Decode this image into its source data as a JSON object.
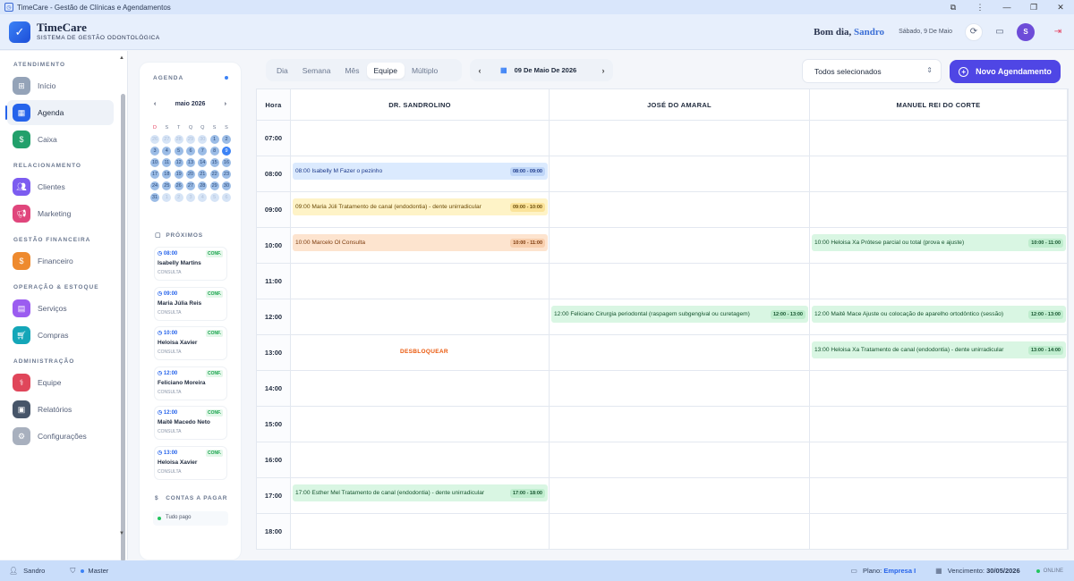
{
  "window": {
    "title": "TimeCare - Gestão de Clínicas e Agendamentos",
    "controls": [
      "⧉",
      "⋮",
      "—",
      "❐",
      "✕"
    ]
  },
  "header": {
    "app_name": "TimeCare",
    "subtitle": "SISTEMA DE GESTÃO ODONTOLÓGICA",
    "greeting": "Bom dia,",
    "user": "Sandro",
    "date": "Sábado, 9 De Maio",
    "avatar": "S"
  },
  "sidebar": {
    "sections": [
      {
        "title": "ATENDIMENTO",
        "items": [
          {
            "label": "Início",
            "icon": "home-icon",
            "color": "#94a3b8"
          },
          {
            "label": "Agenda",
            "icon": "calendar-icon",
            "color": "#2563eb"
          },
          {
            "label": "Caixa",
            "icon": "dollar-icon",
            "color": "#22a06b"
          }
        ]
      },
      {
        "title": "RELACIONAMENTO",
        "items": [
          {
            "label": "Clientes",
            "icon": "users-icon",
            "color": "#7c5cf0"
          },
          {
            "label": "Marketing",
            "icon": "megaphone-icon",
            "color": "#e0467c"
          }
        ]
      },
      {
        "title": "GESTÃO FINANCEIRA",
        "items": [
          {
            "label": "Financeiro",
            "icon": "dollar-icon",
            "color": "#ee8a2e"
          }
        ]
      },
      {
        "title": "OPERAÇÃO & ESTOQUE",
        "items": [
          {
            "label": "Serviços",
            "icon": "clipboard-icon",
            "color": "#9b5cf0"
          },
          {
            "label": "Compras",
            "icon": "cart-icon",
            "color": "#14a6b8"
          }
        ]
      },
      {
        "title": "ADMINISTRAÇÃO",
        "items": [
          {
            "label": "Equipe",
            "icon": "stethoscope-icon",
            "color": "#e0465a"
          },
          {
            "label": "Relatórios",
            "icon": "report-icon",
            "color": "#475569"
          },
          {
            "label": "Configurações",
            "icon": "gear-icon",
            "color": "#a8b0be"
          }
        ]
      }
    ]
  },
  "agenda_panel": {
    "label": "AGENDA",
    "month": "maio 2026",
    "weekdays": [
      "D",
      "S",
      "T",
      "Q",
      "Q",
      "S",
      "S"
    ],
    "weeks": [
      [
        "26",
        "27",
        "28",
        "29",
        "30",
        "1",
        "2"
      ],
      [
        "3",
        "4",
        "5",
        "6",
        "7",
        "8",
        "9"
      ],
      [
        "10",
        "11",
        "12",
        "13",
        "14",
        "15",
        "16"
      ],
      [
        "17",
        "18",
        "19",
        "20",
        "21",
        "22",
        "23"
      ],
      [
        "24",
        "25",
        "26",
        "27",
        "28",
        "29",
        "30"
      ],
      [
        "31",
        "1",
        "2",
        "3",
        "4",
        "5",
        "6"
      ]
    ],
    "proximos_label": "PRÓXIMOS",
    "proximos": [
      {
        "time": "08:00",
        "status": "CONF.",
        "name": "Isabelly Martins",
        "type": "CONSULTA"
      },
      {
        "time": "09:00",
        "status": "CONF.",
        "name": "Maria Júlia Reis",
        "type": "CONSULTA"
      },
      {
        "time": "10:00",
        "status": "CONF.",
        "name": "Heloisa Xavier",
        "type": "CONSULTA"
      },
      {
        "time": "12:00",
        "status": "CONF.",
        "name": "Feliciano Moreira",
        "type": "CONSULTA"
      },
      {
        "time": "12:00",
        "status": "CONF.",
        "name": "Maitê Macedo Neto",
        "type": "CONSULTA"
      },
      {
        "time": "13:00",
        "status": "CONF.",
        "name": "Heloisa Xavier",
        "type": "CONSULTA"
      }
    ],
    "contas_label": "CONTAS A PAGAR",
    "contas_status": "Tudo pago"
  },
  "toolbar": {
    "tabs": [
      "Dia",
      "Semana",
      "Mês",
      "Equipe",
      "Múltiplo"
    ],
    "active_tab": "Equipe",
    "date": "09 De Maio De 2026",
    "filter": "Todos selecionados",
    "new_button": "Novo Agendamento"
  },
  "schedule": {
    "hour_label": "Hora",
    "columns": [
      "DR. SANDROLINO",
      "JOSÉ DO AMARAL",
      "MANUEL REI DO CORTE"
    ],
    "hours": [
      "07:00",
      "08:00",
      "09:00",
      "10:00",
      "11:00",
      "12:00",
      "13:00",
      "14:00",
      "15:00",
      "16:00",
      "17:00",
      "18:00"
    ],
    "unlock_label": "DESBLOQUEAR",
    "events": [
      {
        "col": 0,
        "hour": 1,
        "color": "blue",
        "text": "08:00 Isabelly M Fazer o pezinho",
        "range": "08:00 - 09:00"
      },
      {
        "col": 0,
        "hour": 2,
        "color": "yellow",
        "text": "09:00 Maria Júli Tratamento de canal (endodontia) - dente unirradicular",
        "range": "09:00 - 10:00"
      },
      {
        "col": 0,
        "hour": 3,
        "color": "orange",
        "text": "10:00 Marcelo Ol Consulta",
        "range": "10:00 - 11:00"
      },
      {
        "col": 2,
        "hour": 3,
        "color": "green",
        "text": "10:00 Heloisa Xa Prótese parcial ou total (prova e ajuste)",
        "range": "10:00 - 11:00"
      },
      {
        "col": 1,
        "hour": 5,
        "color": "green",
        "text": "12:00 Feliciano Cirurgia periodontal (raspagem subgengival ou curetagem)",
        "range": "12:00 - 13:00"
      },
      {
        "col": 2,
        "hour": 5,
        "color": "green",
        "text": "12:00 Maitê Mace Ajuste ou colocação de aparelho ortodôntico (sessão)",
        "range": "12:00 - 13:00"
      },
      {
        "col": 2,
        "hour": 6,
        "color": "green",
        "text": "13:00 Heloisa Xa Tratamento de canal (endodontia) - dente unirradicular",
        "range": "13:00 - 14:00"
      },
      {
        "col": 0,
        "hour": 10,
        "color": "green",
        "text": "17:00 Esther Mel Tratamento de canal (endodontia) - dente unirradicular",
        "range": "17:00 - 18:00"
      }
    ]
  },
  "statusbar": {
    "user": "Sandro",
    "role": "Master",
    "plan_label": "Plano:",
    "plan": "Empresa I",
    "due_label": "Vencimento:",
    "due": "30/05/2026",
    "online": "ONLINE"
  }
}
